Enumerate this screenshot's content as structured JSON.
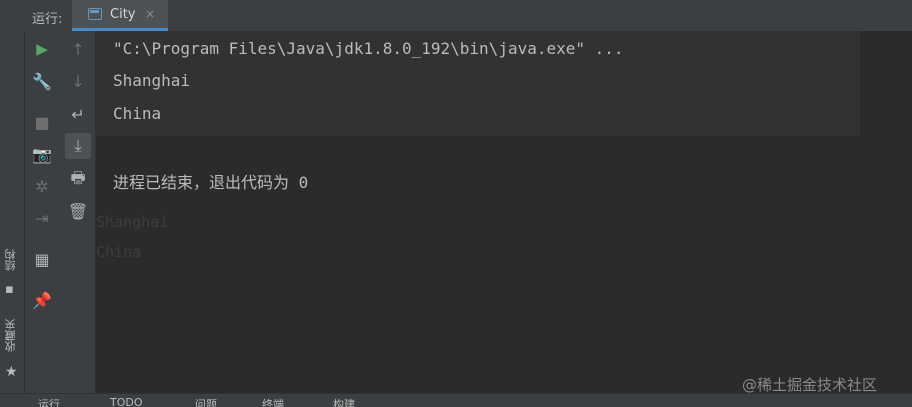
{
  "header": {
    "run_label": "运行:",
    "tab_title": "City",
    "tab_close": "×"
  },
  "left_strip": {
    "structure_label": "结构",
    "favorites_label": "收藏夹"
  },
  "console": {
    "lines": [
      "\"C:\\Program Files\\Java\\jdk1.8.0_192\\bin\\java.exe\" ...",
      "Shanghai",
      "China",
      "",
      "进程已结束，退出代码为 0"
    ],
    "ghost_lines": [
      "Shanghai",
      "China"
    ]
  },
  "bottom_tabs": [
    "运行",
    "TODO",
    "问题",
    "终端",
    "构建"
  ],
  "watermark": "@稀土掘金技术社区",
  "icons": {
    "col1": [
      "play-icon",
      "wrench-icon",
      "stop-icon",
      "camera-icon",
      "bug-icon",
      "login-icon",
      "layout-icon",
      "pin-icon"
    ],
    "col2": [
      "arrow-up-icon",
      "arrow-down-icon",
      "soft-wrap-icon",
      "scroll-to-end-icon",
      "print-icon",
      "trash-icon"
    ]
  }
}
